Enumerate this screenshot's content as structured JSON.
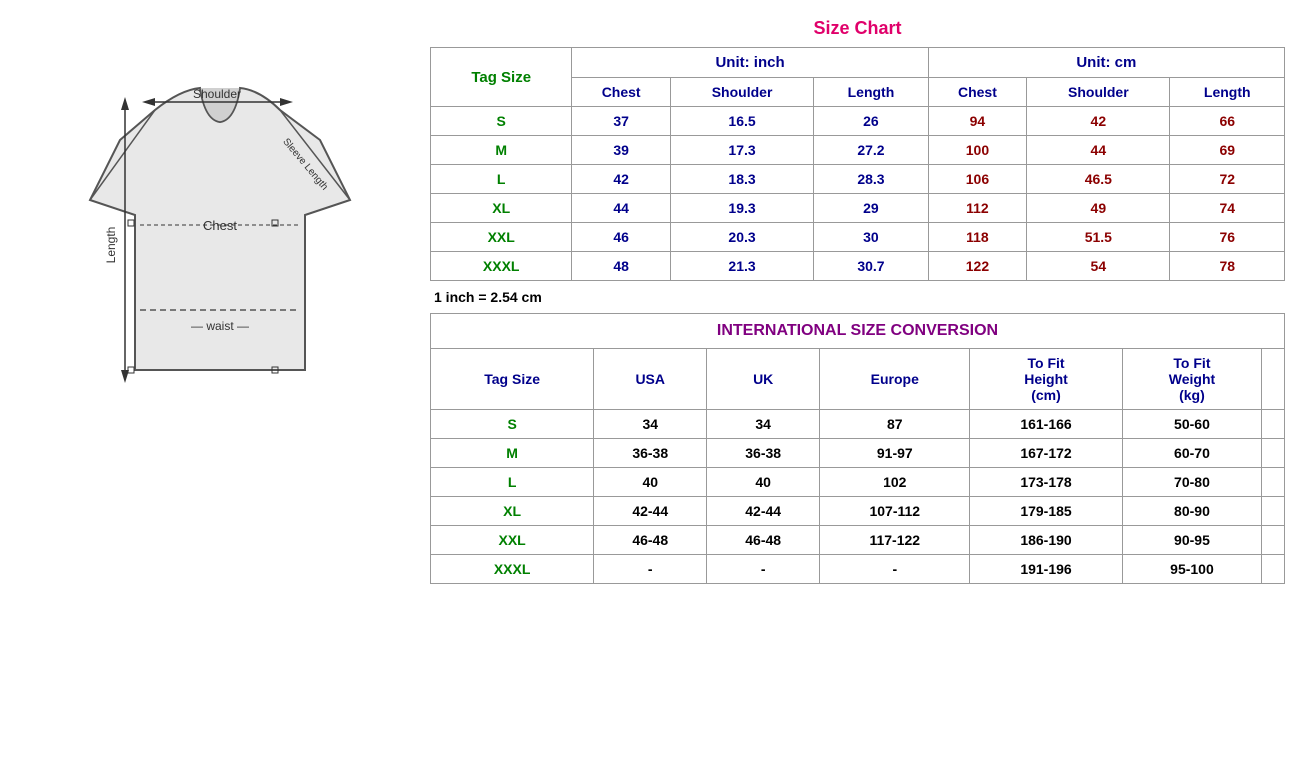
{
  "title": "Size Chart",
  "diagram": {
    "labels": {
      "shoulder": "Shoulder",
      "sleeve_length": "Sleeve Length",
      "chest": "Chest",
      "length": "Length",
      "waist": "waist"
    }
  },
  "size_chart": {
    "title": "Size Chart",
    "unit_inch": "Unit: inch",
    "unit_cm": "Unit: cm",
    "tag_size_label": "Tag Size",
    "columns_inch": [
      "Chest",
      "Shoulder",
      "Length"
    ],
    "columns_cm": [
      "Chest",
      "Shoulder",
      "Length"
    ],
    "rows": [
      {
        "tag": "S",
        "inch_chest": "37",
        "inch_shoulder": "16.5",
        "inch_length": "26",
        "cm_chest": "94",
        "cm_shoulder": "42",
        "cm_length": "66"
      },
      {
        "tag": "M",
        "inch_chest": "39",
        "inch_shoulder": "17.3",
        "inch_length": "27.2",
        "cm_chest": "100",
        "cm_shoulder": "44",
        "cm_length": "69"
      },
      {
        "tag": "L",
        "inch_chest": "42",
        "inch_shoulder": "18.3",
        "inch_length": "28.3",
        "cm_chest": "106",
        "cm_shoulder": "46.5",
        "cm_length": "72"
      },
      {
        "tag": "XL",
        "inch_chest": "44",
        "inch_shoulder": "19.3",
        "inch_length": "29",
        "cm_chest": "112",
        "cm_shoulder": "49",
        "cm_length": "74"
      },
      {
        "tag": "XXL",
        "inch_chest": "46",
        "inch_shoulder": "20.3",
        "inch_length": "30",
        "cm_chest": "118",
        "cm_shoulder": "51.5",
        "cm_length": "76"
      },
      {
        "tag": "XXXL",
        "inch_chest": "48",
        "inch_shoulder": "21.3",
        "inch_length": "30.7",
        "cm_chest": "122",
        "cm_shoulder": "54",
        "cm_length": "78"
      }
    ],
    "conversion_note": "1 inch = 2.54 cm"
  },
  "international": {
    "title": "INTERNATIONAL SIZE CONVERSION",
    "tag_size_label": "Tag Size",
    "columns": [
      "USA",
      "UK",
      "Europe",
      "To Fit\nHeight\n(cm)",
      "To Fit\nWeight\n(kg)"
    ],
    "col_tofit_height": "To Fit Height (cm)",
    "col_tofit_weight": "To Fit Weight (kg)",
    "col_usa": "USA",
    "col_uk": "UK",
    "col_europe": "Europe",
    "rows": [
      {
        "tag": "S",
        "usa": "34",
        "uk": "34",
        "europe": "87",
        "height": "161-166",
        "weight": "50-60"
      },
      {
        "tag": "M",
        "usa": "36-38",
        "uk": "36-38",
        "europe": "91-97",
        "height": "167-172",
        "weight": "60-70"
      },
      {
        "tag": "L",
        "usa": "40",
        "uk": "40",
        "europe": "102",
        "height": "173-178",
        "weight": "70-80"
      },
      {
        "tag": "XL",
        "usa": "42-44",
        "uk": "42-44",
        "europe": "107-112",
        "height": "179-185",
        "weight": "80-90"
      },
      {
        "tag": "XXL",
        "usa": "46-48",
        "uk": "46-48",
        "europe": "117-122",
        "height": "186-190",
        "weight": "90-95"
      },
      {
        "tag": "XXXL",
        "usa": "-",
        "uk": "-",
        "europe": "-",
        "height": "191-196",
        "weight": "95-100"
      }
    ]
  }
}
